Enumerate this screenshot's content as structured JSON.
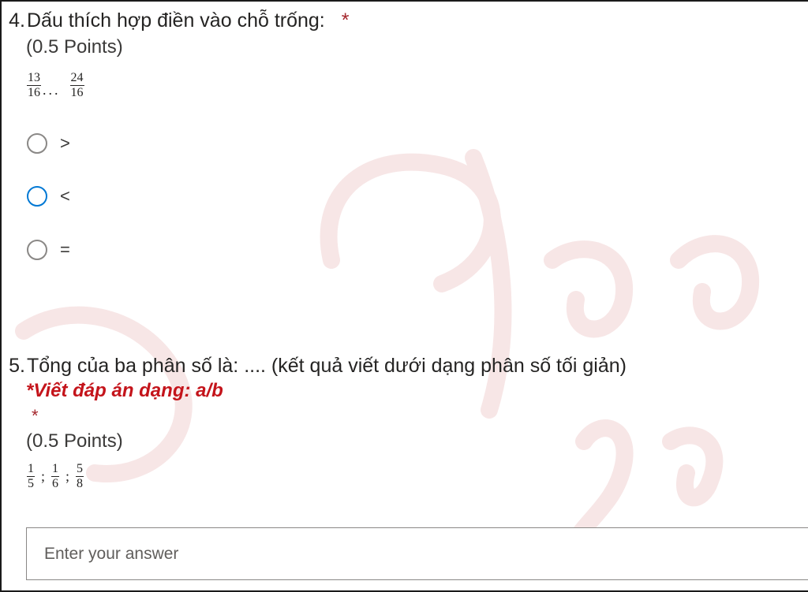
{
  "q4": {
    "number": "4.",
    "title": "Dấu thích hợp điền vào chỗ trống:",
    "required_mark": "*",
    "points": "(0.5 Points)",
    "fraction_a": {
      "num": "13",
      "den": "16"
    },
    "blank": "...",
    "fraction_b": {
      "num": "24",
      "den": "16"
    },
    "options": [
      {
        "label": ">",
        "selected": false
      },
      {
        "label": "<",
        "selected": false
      },
      {
        "label": "=",
        "selected": false
      }
    ]
  },
  "q5": {
    "number": "5.",
    "title": "Tổng của ba phân số là: .... (kết quả viết dưới dạng phân số tối giản)",
    "instruction": "*Viết đáp án dạng: a/b",
    "required_mark": "*",
    "points": "(0.5 Points)",
    "fractions": [
      {
        "num": "1",
        "den": "5"
      },
      {
        "num": "1",
        "den": "6"
      },
      {
        "num": "5",
        "den": "8"
      }
    ],
    "separator": ";",
    "answer_placeholder": "Enter your answer",
    "answer_value": ""
  },
  "colors": {
    "required": "#a4262c",
    "emphasis": "#c4141b",
    "focus": "#0078d4"
  }
}
